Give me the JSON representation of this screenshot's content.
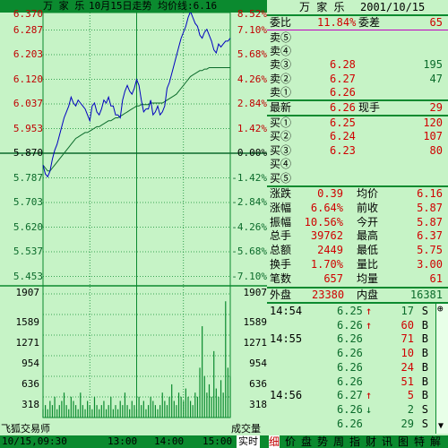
{
  "chart": {
    "title": {
      "stock": "万 家 乐",
      "date": "10月15日走势",
      "avg_label": "均价线:6.16"
    },
    "price_left": [
      "6.370",
      "6.287",
      "6.203",
      "6.120",
      "6.037",
      "5.953",
      "5.870",
      "5.787",
      "5.703",
      "5.620",
      "5.537",
      "5.453"
    ],
    "pct_right": [
      "8.52%",
      "7.10%",
      "5.68%",
      "4.26%",
      "2.84%",
      "1.42%",
      "0.00%",
      "-1.42%",
      "-2.84%",
      "-4.26%",
      "-5.68%",
      "-7.10%"
    ],
    "vol_left": [
      "1907",
      "1589",
      "1271",
      "954",
      "636",
      "318"
    ],
    "vol_right": [
      "1907",
      "1589",
      "1271",
      "954",
      "636",
      "318"
    ],
    "vol_label_left": "飞狐交易师",
    "vol_label_right": "成交量",
    "xaxis": [
      "10/15,09:30",
      "13:00",
      "14:00",
      "15:00"
    ],
    "mode_label": "实时"
  },
  "chart_data": {
    "type": "line",
    "title": "10月15日走势",
    "ylabel": "",
    "ylim": [
      5.37,
      6.37
    ],
    "prev_close": 5.87,
    "x": [
      0,
      3,
      6,
      9,
      12,
      15,
      18,
      21,
      24,
      27,
      30,
      33,
      36,
      39,
      42,
      45,
      48,
      51,
      54,
      57,
      60,
      63,
      66,
      69,
      72,
      75,
      78,
      81,
      84,
      87,
      90,
      93,
      96,
      99,
      102,
      105,
      108,
      111,
      114,
      117,
      120,
      123,
      126,
      129,
      132,
      135,
      138,
      141,
      144,
      147,
      150,
      153,
      156,
      159,
      162,
      165,
      168,
      171,
      174,
      177,
      180,
      183,
      186,
      189,
      192,
      195,
      198,
      201,
      204,
      207,
      210,
      213,
      216,
      219,
      222,
      225,
      228,
      231,
      234,
      237,
      240
    ],
    "series": [
      {
        "values": [
          5.83,
          5.8,
          5.79,
          5.81,
          5.85,
          5.88,
          5.9,
          5.93,
          5.96,
          5.99,
          6.01,
          6.03,
          6.06,
          6.04,
          6.03,
          6.05,
          6.04,
          6.03,
          6.02,
          6.0,
          5.98,
          6.03,
          6.04,
          6.01,
          6.0,
          6.02,
          6.05,
          6.04,
          6.06,
          6.03,
          6.03,
          6.0,
          6.0,
          5.99,
          6.05,
          6.08,
          6.1,
          6.08,
          6.07,
          6.09,
          6.12,
          6.1,
          6.05,
          6.01,
          6.02,
          6.02,
          6.05,
          6.0,
          6.01,
          6.03,
          6.0,
          6.01,
          6.03,
          6.09,
          6.11,
          6.14,
          6.17,
          6.2,
          6.23,
          6.26,
          6.28,
          6.3,
          6.33,
          6.35,
          6.33,
          6.31,
          6.3,
          6.27,
          6.26,
          6.28,
          6.29,
          6.27,
          6.25,
          6.22,
          6.21,
          6.24,
          6.23,
          6.24,
          6.25,
          6.25,
          6.26
        ]
      },
      {
        "values": [
          5.83,
          5.82,
          5.81,
          5.81,
          5.82,
          5.83,
          5.84,
          5.85,
          5.86,
          5.87,
          5.88,
          5.89,
          5.9,
          5.91,
          5.92,
          5.925,
          5.93,
          5.935,
          5.94,
          5.94,
          5.945,
          5.95,
          5.955,
          5.96,
          5.96,
          5.965,
          5.97,
          5.975,
          5.98,
          5.98,
          5.985,
          5.99,
          5.99,
          5.995,
          6.0,
          6.005,
          6.01,
          6.015,
          6.02,
          6.025,
          6.03,
          6.03,
          6.035,
          6.035,
          6.035,
          6.035,
          6.04,
          6.04,
          6.04,
          6.04,
          6.04,
          6.04,
          6.045,
          6.05,
          6.055,
          6.06,
          6.065,
          6.07,
          6.08,
          6.09,
          6.1,
          6.11,
          6.12,
          6.13,
          6.135,
          6.14,
          6.145,
          6.15,
          6.15,
          6.155,
          6.155,
          6.16,
          6.16,
          6.16,
          6.16,
          6.16,
          6.16,
          6.16,
          6.16,
          6.16,
          6.16
        ]
      }
    ],
    "volume": [
      2,
      3,
      2,
      4,
      3,
      5,
      2,
      3,
      4,
      6,
      3,
      2,
      5,
      4,
      3,
      2,
      6,
      3,
      2,
      4,
      3,
      2,
      5,
      3,
      2,
      3,
      4,
      2,
      3,
      5,
      2,
      3,
      2,
      4,
      3,
      6,
      3,
      2,
      4,
      3,
      2,
      5,
      3,
      4,
      2,
      3,
      5,
      4,
      3,
      2,
      3,
      6,
      4,
      3,
      5,
      8,
      4,
      3,
      6,
      5,
      4,
      7,
      5,
      4,
      3,
      6,
      5,
      12,
      22,
      10,
      6,
      8,
      5,
      16,
      7,
      5,
      9,
      6,
      28,
      12,
      10
    ],
    "vol_ylim": [
      0,
      1907
    ]
  },
  "quote": {
    "header": {
      "name": "万 家 乐",
      "date": "2001/10/15"
    },
    "weibi": {
      "label": "委比",
      "value": "11.84%",
      "label2": "委差",
      "value2": "65"
    },
    "sell": [
      {
        "label": "卖⑤",
        "price": "",
        "vol": ""
      },
      {
        "label": "卖④",
        "price": "",
        "vol": ""
      },
      {
        "label": "卖③",
        "price": "6.28",
        "vol": "195"
      },
      {
        "label": "卖②",
        "price": "6.27",
        "vol": "47"
      },
      {
        "label": "卖①",
        "price": "6.26",
        "vol": ""
      }
    ],
    "latest": {
      "label": "最新",
      "value": "6.26",
      "label2": "现手",
      "value2": "29"
    },
    "buy": [
      {
        "label": "买①",
        "price": "6.25",
        "vol": "120"
      },
      {
        "label": "买②",
        "price": "6.24",
        "vol": "107"
      },
      {
        "label": "买③",
        "price": "6.23",
        "vol": "80"
      },
      {
        "label": "买④",
        "price": "",
        "vol": ""
      },
      {
        "label": "买⑤",
        "price": "",
        "vol": ""
      }
    ],
    "stats": [
      {
        "l1": "涨跌",
        "v1": "0.39",
        "l2": "均价",
        "v2": "6.16"
      },
      {
        "l1": "涨幅",
        "v1": "6.64%",
        "l2": "前收",
        "v2": "5.87"
      },
      {
        "l1": "振幅",
        "v1": "10.56%",
        "l2": "今开",
        "v2": "5.87"
      },
      {
        "l1": "总手",
        "v1": "39762",
        "l2": "最高",
        "v2": "6.37"
      },
      {
        "l1": "总额",
        "v1": "2449",
        "l2": "最低",
        "v2": "5.75"
      },
      {
        "l1": "换手",
        "v1": "1.70%",
        "l2": "量比",
        "v2": "3.00"
      },
      {
        "l1": "笔数",
        "v1": "657",
        "l2": "均量",
        "v2": "61"
      }
    ],
    "outin": {
      "l1": "外盘",
      "v1": "23380",
      "l2": "内盘",
      "v2": "16381"
    },
    "ticks": [
      {
        "time": "14:54",
        "price": "6.25",
        "arrow": "↑",
        "vol": "17",
        "side": "S"
      },
      {
        "time": "",
        "price": "6.26",
        "arrow": "↑",
        "vol": "60",
        "side": "B"
      },
      {
        "time": "14:55",
        "price": "6.26",
        "arrow": "",
        "vol": "71",
        "side": "B"
      },
      {
        "time": "",
        "price": "6.26",
        "arrow": "",
        "vol": "10",
        "side": "B"
      },
      {
        "time": "",
        "price": "6.26",
        "arrow": "",
        "vol": "24",
        "side": "B"
      },
      {
        "time": "",
        "price": "6.26",
        "arrow": "",
        "vol": "51",
        "side": "B"
      },
      {
        "time": "14:56",
        "price": "6.27",
        "arrow": "↑",
        "vol": "5",
        "side": "B"
      },
      {
        "time": "",
        "price": "6.26",
        "arrow": "↓",
        "vol": "2",
        "side": "S"
      },
      {
        "time": "",
        "price": "6.26",
        "arrow": "",
        "vol": "29",
        "side": "S"
      }
    ],
    "tabs": [
      "细",
      "价",
      "盘",
      "势",
      "周",
      "指",
      "财",
      "讯",
      "图",
      "特",
      "解"
    ]
  },
  "colors": {
    "up": "#d00000",
    "down": "#0b6b2b",
    "chart_bg": "#c6f3c6",
    "bar": "#0b8a2f",
    "price_line": "#0000c0",
    "avg_line": "#0b6b2b"
  }
}
